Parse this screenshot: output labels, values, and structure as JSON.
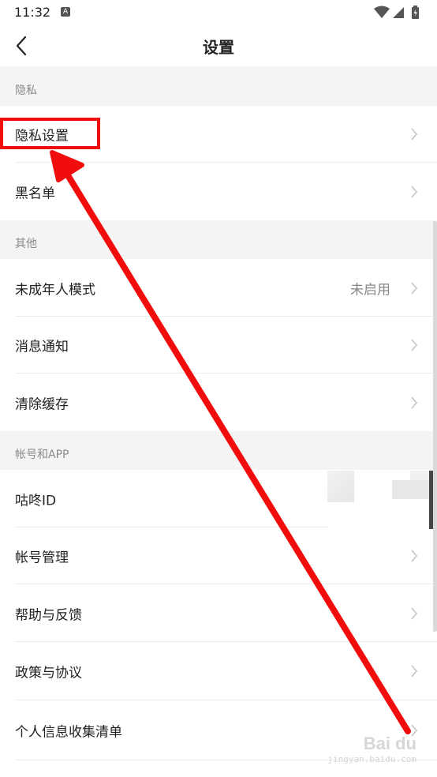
{
  "status_bar": {
    "time": "11:32",
    "notification_badge": "A",
    "icons": [
      "wifi-icon",
      "signal-icon",
      "battery-icon"
    ]
  },
  "nav": {
    "title": "设置",
    "back_icon": "chevron-left-icon"
  },
  "sections": [
    {
      "header": "隐私",
      "items": [
        {
          "label": "隐私设置"
        },
        {
          "label": "黑名单"
        }
      ]
    },
    {
      "header": "其他",
      "items": [
        {
          "label": "未成年人模式",
          "value": "未启用"
        },
        {
          "label": "消息通知"
        },
        {
          "label": "清除缓存"
        }
      ]
    },
    {
      "header": "帐号和APP",
      "items": [
        {
          "label": "咕咚ID"
        },
        {
          "label": "帐号管理"
        },
        {
          "label": "帮助与反馈"
        },
        {
          "label": "政策与协议"
        },
        {
          "label": "个人信息收集清单"
        }
      ]
    }
  ],
  "annotation": {
    "color": "#f20d0d",
    "target": "隐私设置"
  },
  "watermark": {
    "logo": "Bai du",
    "sub": "jingyan.baidu.com"
  },
  "colors": {
    "section_bg": "#f4f4f4",
    "divider": "#ececec",
    "text": "#222222",
    "muted": "#8a8a8a",
    "chevron": "#c4c4c4"
  }
}
